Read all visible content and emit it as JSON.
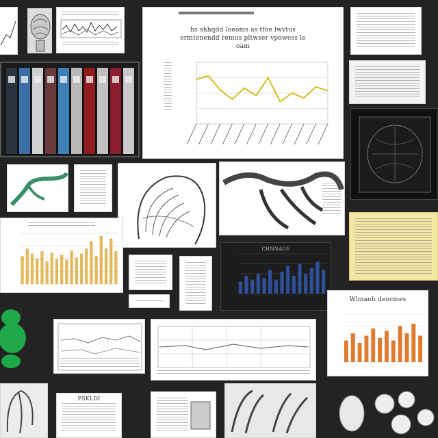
{
  "background": "#232323",
  "colors": {
    "yellow_line": "#d4bc1e",
    "amber_bar": "#e3b95c",
    "navy_bar": "#2f4f9b",
    "orange_bar": "#e07a2e",
    "green_blob": "#1ea84a",
    "teal_path": "#3a8f6b",
    "binder_colors": [
      "#2a3340",
      "#3b6fa8",
      "#d0d0d0",
      "#6b3b3b",
      "#3c80b7",
      "#b9b9b9",
      "#8f1d1d",
      "#c0c0c0",
      "#8a1c2e",
      "#c9c9c9"
    ]
  },
  "big_doc": {
    "heading": "hs shhqdd loeoms as tfoe lwvtus",
    "subheading": "ermtenendd remus pltwser vpowess le",
    "sub2": "oam"
  },
  "panel_orange": {
    "heading": "Wlmaoh deocmes"
  },
  "dark_chart": {
    "heading": "CHNNAOE"
  },
  "bottom_card": {
    "heading": "PSKLDI"
  },
  "chart_data": [
    {
      "type": "line",
      "series": [
        {
          "values": [
            0.72,
            0.78,
            0.55,
            0.4,
            0.58,
            0.46,
            0.75,
            0.36,
            0.5,
            0.42,
            0.6,
            0.54
          ]
        }
      ]
    },
    {
      "type": "bar",
      "series": [
        {
          "values": [
            0.55,
            0.7,
            0.6,
            0.5,
            0.65,
            0.45,
            0.62,
            0.5,
            0.58,
            0.48,
            0.66,
            0.52,
            0.6,
            0.7,
            0.85,
            0.55,
            0.95,
            0.7,
            0.9,
            0.65
          ]
        }
      ]
    },
    {
      "type": "bar",
      "series": [
        {
          "values": [
            0.3,
            0.45,
            0.35,
            0.5,
            0.4,
            0.6,
            0.35,
            0.55,
            0.7,
            0.45,
            0.75,
            0.5,
            0.65,
            0.8,
            0.6
          ]
        }
      ]
    },
    {
      "type": "bar",
      "series": [
        {
          "values": [
            0.45,
            0.6,
            0.4,
            0.55,
            0.7,
            0.5,
            0.65,
            0.45,
            0.75,
            0.6,
            0.8,
            0.55
          ]
        }
      ]
    }
  ]
}
